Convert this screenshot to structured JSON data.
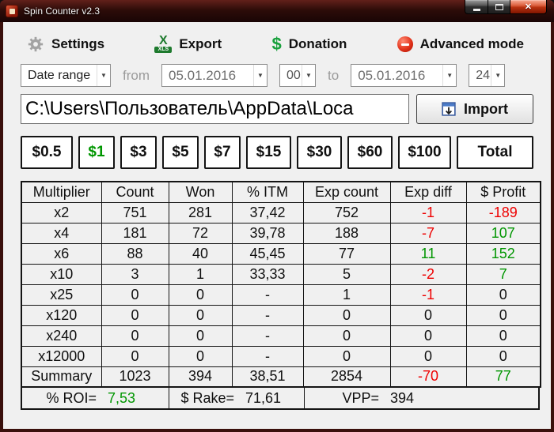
{
  "colors": {
    "red": "#ee0000",
    "green": "#009600"
  },
  "titlebar": {
    "title": "Spin Counter v2.3"
  },
  "window_controls": {
    "close": "✕"
  },
  "toolbar": {
    "settings": "Settings",
    "export": "Export",
    "export_icon_x": "X",
    "export_icon_tag": "XLS",
    "donation": "Donation",
    "donation_icon": "$",
    "advanced_mode": "Advanced mode"
  },
  "filters": {
    "range_type": "Date range",
    "from_label": "from",
    "from_date": "05.01.2016",
    "from_hour": "00",
    "to_label": "to",
    "to_date": "05.01.2016",
    "to_hour": "24"
  },
  "import_bar": {
    "path": "C:\\Users\\Пользователь\\AppData\\Loca",
    "button_label": "Import"
  },
  "buyins": [
    {
      "label": "$0.5",
      "selected": false
    },
    {
      "label": "$1",
      "selected": true
    },
    {
      "label": "$3",
      "selected": false
    },
    {
      "label": "$5",
      "selected": false
    },
    {
      "label": "$7",
      "selected": false
    },
    {
      "label": "$15",
      "selected": false
    },
    {
      "label": "$30",
      "selected": false
    },
    {
      "label": "$60",
      "selected": false
    },
    {
      "label": "$100",
      "selected": false
    },
    {
      "label": "Total",
      "selected": false
    }
  ],
  "table": {
    "headers": [
      "Multiplier",
      "Count",
      "Won",
      "% ITM",
      "Exp count",
      "Exp diff",
      "$ Profit"
    ],
    "rows": [
      {
        "cells": [
          "x2",
          "751",
          "281",
          "37,42",
          "752",
          "-1",
          "-189"
        ],
        "colors": [
          "",
          "",
          "",
          "",
          "",
          "red",
          "red"
        ]
      },
      {
        "cells": [
          "x4",
          "181",
          "72",
          "39,78",
          "188",
          "-7",
          "107"
        ],
        "colors": [
          "",
          "",
          "",
          "",
          "",
          "red",
          "green"
        ]
      },
      {
        "cells": [
          "x6",
          "88",
          "40",
          "45,45",
          "77",
          "11",
          "152"
        ],
        "colors": [
          "",
          "",
          "",
          "",
          "",
          "green",
          "green"
        ]
      },
      {
        "cells": [
          "x10",
          "3",
          "1",
          "33,33",
          "5",
          "-2",
          "7"
        ],
        "colors": [
          "",
          "",
          "",
          "",
          "",
          "red",
          "green"
        ]
      },
      {
        "cells": [
          "x25",
          "0",
          "0",
          "-",
          "1",
          "-1",
          "0"
        ],
        "colors": [
          "",
          "",
          "",
          "",
          "",
          "red",
          ""
        ]
      },
      {
        "cells": [
          "x120",
          "0",
          "0",
          "-",
          "0",
          "0",
          "0"
        ],
        "colors": [
          "",
          "",
          "",
          "",
          "",
          "",
          ""
        ]
      },
      {
        "cells": [
          "x240",
          "0",
          "0",
          "-",
          "0",
          "0",
          "0"
        ],
        "colors": [
          "",
          "",
          "",
          "",
          "",
          "",
          ""
        ]
      },
      {
        "cells": [
          "x12000",
          "0",
          "0",
          "-",
          "0",
          "0",
          "0"
        ],
        "colors": [
          "",
          "",
          "",
          "",
          "",
          "",
          ""
        ]
      },
      {
        "cells": [
          "Summary",
          "1023",
          "394",
          "38,51",
          "2854",
          "-70",
          "77"
        ],
        "colors": [
          "",
          "",
          "",
          "",
          "",
          "red",
          "green"
        ]
      }
    ]
  },
  "footer": {
    "roi_label": "% ROI=",
    "roi_value": "7,53",
    "rake_label": "$ Rake=",
    "rake_value": "71,61",
    "vpp_label": "VPP=",
    "vpp_value": "394"
  }
}
